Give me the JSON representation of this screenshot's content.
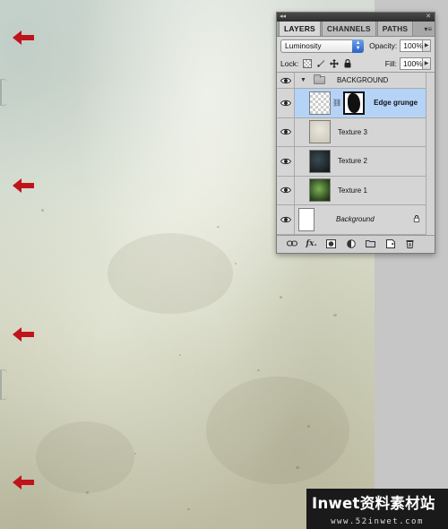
{
  "layers_panel": {
    "tabs": [
      {
        "label": "LAYERS",
        "active": true
      },
      {
        "label": "CHANNELS",
        "active": false
      },
      {
        "label": "PATHS",
        "active": false
      }
    ],
    "blend_mode": "Luminosity",
    "opacity_label": "Opacity:",
    "opacity_value": "100%",
    "lock_label": "Lock:",
    "fill_label": "Fill:",
    "fill_value": "100%",
    "group": {
      "name": "BACKGROUND",
      "expanded": true
    },
    "layers": [
      {
        "name": "Edge grunge",
        "selected": true,
        "has_mask": true,
        "thumbnail": "transparent"
      },
      {
        "name": "Texture 3",
        "selected": false,
        "thumbnail": "light-texture"
      },
      {
        "name": "Texture 2",
        "selected": false,
        "thumbnail": "dark-texture"
      },
      {
        "name": "Texture 1",
        "selected": false,
        "thumbnail": "green-texture"
      }
    ],
    "background_layer": {
      "name": "Background",
      "locked": true
    },
    "bottom_icons": [
      "link-layers-icon",
      "fx-icon",
      "add-mask-icon",
      "adjustment-layer-icon",
      "new-group-icon",
      "new-layer-icon",
      "trash-icon"
    ]
  },
  "annotation_arrows": {
    "count": 4,
    "color": "#c0141c",
    "direction": "left"
  },
  "watermark": {
    "title": "Inwet资料素材站",
    "url": "www.52inwet.com"
  },
  "colors": {
    "selection": "#b5d3f7",
    "stepper_accent": "#3b73d6",
    "arrow": "#c0141c"
  }
}
